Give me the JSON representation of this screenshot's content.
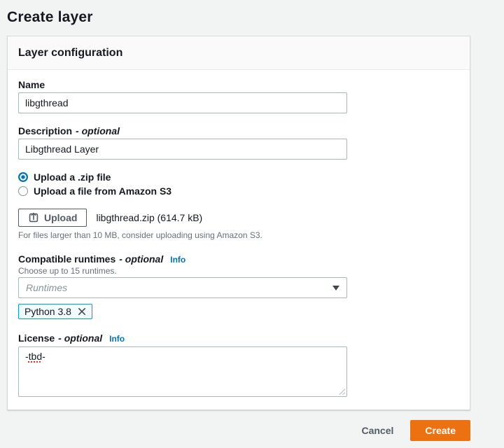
{
  "page": {
    "title": "Create layer"
  },
  "card": {
    "header": "Layer configuration",
    "name": {
      "label": "Name",
      "value": "libgthread"
    },
    "description": {
      "label": "Description",
      "optional": "- optional",
      "value": "Libgthread Layer"
    },
    "upload": {
      "radio_zip_label": "Upload a .zip file",
      "radio_s3_label": "Upload a file from Amazon S3",
      "button_label": "Upload",
      "file_info": "libgthread.zip (614.7 kB)",
      "hint": "For files larger than 10 MB, consider uploading using Amazon S3."
    },
    "runtimes": {
      "label": "Compatible runtimes",
      "optional": "- optional",
      "info": "Info",
      "hint": "Choose up to 15 runtimes.",
      "placeholder": "Runtimes",
      "token": "Python 3.8"
    },
    "license": {
      "label": "License",
      "optional": "- optional",
      "info": "Info",
      "value_prefix": "-",
      "value_misspelled": "tbd",
      "value_suffix": "-"
    }
  },
  "footer": {
    "cancel": "Cancel",
    "create": "Create"
  },
  "colors": {
    "accent_orange": "#ec7211",
    "link_blue": "#0073bb",
    "token_border": "#00a1c9",
    "page_background": "#f2f3f3"
  }
}
